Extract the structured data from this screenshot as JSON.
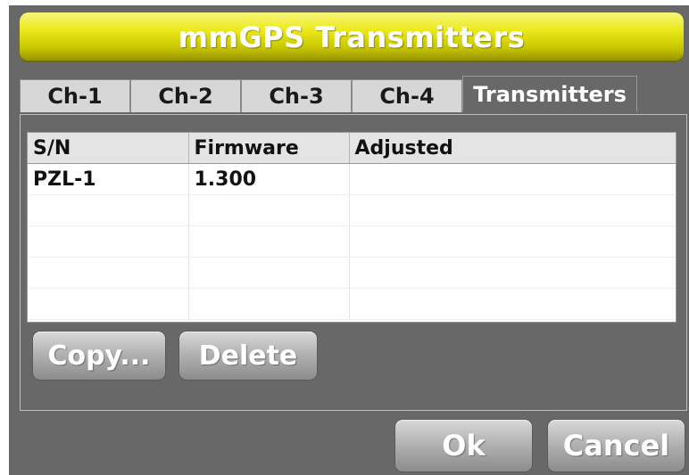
{
  "window": {
    "title": "mmGPS Transmitters"
  },
  "tabs": [
    {
      "label": "Ch-1",
      "active": false
    },
    {
      "label": "Ch-2",
      "active": false
    },
    {
      "label": "Ch-3",
      "active": false
    },
    {
      "label": "Ch-4",
      "active": false
    },
    {
      "label": "Transmitters",
      "active": true
    }
  ],
  "table": {
    "columns": [
      "S/N",
      "Firmware",
      "Adjusted"
    ],
    "rows": [
      [
        "PZL-1",
        "1.300",
        ""
      ],
      [
        "",
        "",
        ""
      ],
      [
        "",
        "",
        ""
      ],
      [
        "",
        "",
        ""
      ],
      [
        "",
        "",
        ""
      ]
    ]
  },
  "buttons": {
    "copy": "Copy...",
    "delete": "Delete",
    "ok": "Ok",
    "cancel": "Cancel"
  },
  "colors": {
    "title_bar": "#ecea1c",
    "window_bg": "#686868",
    "tab_bg": "#d7d7d7"
  }
}
